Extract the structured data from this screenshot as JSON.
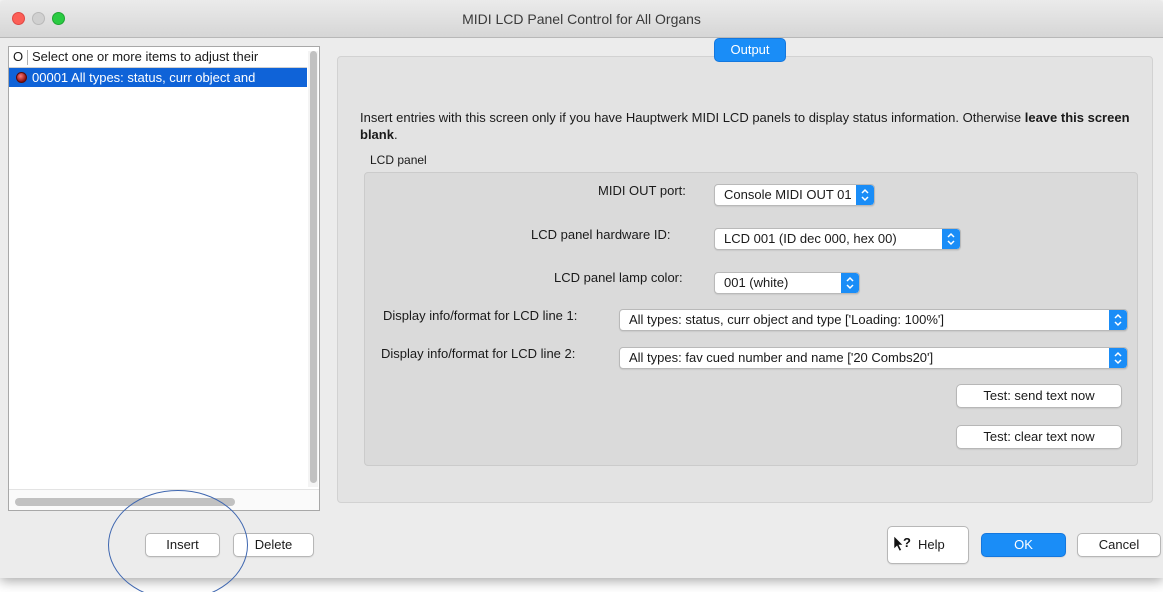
{
  "window": {
    "title": "MIDI LCD Panel Control for All Organs"
  },
  "list": {
    "header_col_o": "O",
    "header_desc": "Select one or more items to adjust their",
    "rows": [
      {
        "text": "00001 All types: status, curr object and",
        "selected": true
      }
    ]
  },
  "tab": {
    "label": "Output"
  },
  "intro": {
    "text": "Insert entries with this screen only if you have Hauptwerk MIDI LCD panels to display status information. Otherwise ",
    "bold": "leave this screen blank",
    "end": "."
  },
  "group": {
    "label": "LCD panel"
  },
  "form": {
    "midi_out_label": "MIDI OUT port:",
    "midi_out_value": "Console MIDI OUT 01",
    "hardware_id_label": "LCD panel hardware ID:",
    "hardware_id_value": "LCD 001 (ID dec 000, hex 00)",
    "lamp_color_label": "LCD panel lamp color:",
    "lamp_color_value": "001 (white)",
    "line1_label": "Display info/format for LCD line 1:",
    "line1_value": "All types: status, curr object and type ['Loading: 100%']",
    "line2_label": "Display info/format for LCD line 2:",
    "line2_value": "All types: fav cued number and name ['20 Combs20']",
    "test_send_label": "Test: send text now",
    "test_clear_label": "Test: clear text now"
  },
  "footer": {
    "insert_label": "Insert",
    "delete_label": "Delete",
    "help_label": "Help",
    "ok_label": "OK",
    "cancel_label": "Cancel"
  },
  "colors": {
    "accent": "#1a8df7",
    "selection": "#0f63d8",
    "annotation": "#3f67b0"
  },
  "icons": {
    "help": "question-arrow-icon",
    "stepper": "up-down-chevron-icon",
    "row_status": "red-dot-icon"
  }
}
